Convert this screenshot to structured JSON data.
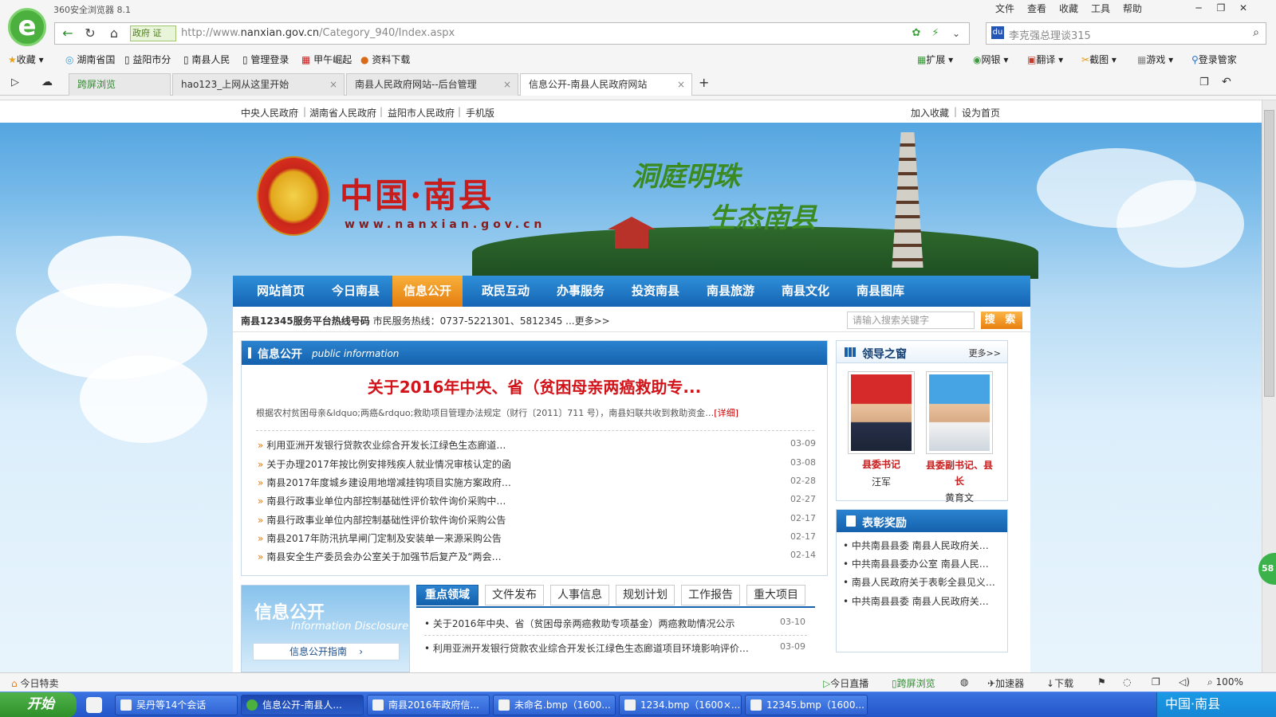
{
  "browser": {
    "app_name": "360安全浏览器 8.1",
    "menu": [
      "文件",
      "查看",
      "收藏",
      "工具",
      "帮助"
    ],
    "gov_badge": "政府 证",
    "url_prefix": "http://www.",
    "url_domain": "nanxian.gov.cn",
    "url_path": "/Category_940/Index.aspx",
    "search_value": "李克强总理谈315",
    "bookmarks": [
      "收藏",
      "湖南省国",
      "益阳市分",
      "南县人民",
      "管理登录",
      "甲午崛起",
      "资料下载"
    ],
    "toolbar_right": [
      "扩展",
      "网银",
      "翻译",
      "截图",
      "游戏",
      "登录管家"
    ],
    "tabs": [
      {
        "label": "跨屏浏览"
      },
      {
        "label": "hao123_上网从这里开始"
      },
      {
        "label": "南县人民政府网站--后台管理"
      },
      {
        "label": "信息公开-南县人民政府网站"
      }
    ]
  },
  "site": {
    "top_links": [
      "中央人民政府",
      "湖南省人民政府",
      "益阳市人民政府",
      "手机版"
    ],
    "top_right": [
      "加入收藏",
      "设为首页"
    ],
    "name": "中国·南县",
    "url": "www.nanxian.gov.cn",
    "slogan_1": "洞庭明珠",
    "slogan_2": "生态南县",
    "nav": [
      "网站首页",
      "今日南县",
      "信息公开",
      "政民互动",
      "办事服务",
      "投资南县",
      "南县旅游",
      "南县文化",
      "南县图库"
    ],
    "active_nav": "信息公开",
    "hotline_title": "南县12345服务平台热线号码",
    "hotline_text": "市民服务热线：0737-5221301、5812345 ...更多>>",
    "search_placeholder": "请输入搜索关键字",
    "search_button": "搜 索"
  },
  "info": {
    "title": "信息公开",
    "title_en": "public information",
    "headline": "关于2016年中央、省（贫困母亲两癌救助专...",
    "summary": "根据农村贫困母亲&ldquo;两癌&rdquo;救助项目管理办法规定（财行〔2011〕711 号），南县妇联共收到救助资金…",
    "detail_link": "[详细]",
    "news": [
      {
        "title": "利用亚洲开发银行贷款农业综合开发长江绿色生态廊道…",
        "date": "03-09"
      },
      {
        "title": "关于办理2017年按比例安排残疾人就业情况审核认定的函",
        "date": "03-08"
      },
      {
        "title": "南县2017年度城乡建设用地增减挂钩项目实施方案政府…",
        "date": "02-28"
      },
      {
        "title": "南县行政事业单位内部控制基础性评价软件询价采购中…",
        "date": "02-27"
      },
      {
        "title": "南县行政事业单位内部控制基础性评价软件询价采购公告",
        "date": "02-17"
      },
      {
        "title": "南县2017年防汛抗旱闸门定制及安装单一来源采购公告",
        "date": "02-17"
      },
      {
        "title": "南县安全生产委员会办公室关于加强节后复产及“两会…",
        "date": "02-14"
      }
    ]
  },
  "disclosure": {
    "title": "信息公开",
    "title_en": "Information Disclosure",
    "guide": "信息公开指南"
  },
  "bottom_tabs": [
    "重点领域",
    "文件发布",
    "人事信息",
    "规划计划",
    "工作报告",
    "重大项目"
  ],
  "bottom_news": [
    {
      "title": "关于2016年中央、省（贫困母亲两癌救助专项基金）两癌救助情况公示",
      "date": "03-10"
    },
    {
      "title": "利用亚洲开发银行贷款农业综合开发长江绿色生态廊道项目环境影响评价…",
      "date": "03-09"
    }
  ],
  "leaders": {
    "title": "领导之窗",
    "more": "更多>>",
    "people": [
      {
        "role": "县委书记",
        "name": "汪军"
      },
      {
        "role": "县委副书记、县长",
        "name": "黄育文"
      }
    ]
  },
  "awards": {
    "title": "表彰奖励",
    "items": [
      "中共南县县委 南县人民政府关…",
      "中共南县县委办公室 南县人民…",
      "南县人民政府关于表彰全县见义…",
      "中共南县县委 南县人民政府关…"
    ]
  },
  "status": {
    "left": "今日特卖",
    "right": [
      "今日直播",
      "跨屏浏览",
      "加速器",
      "下载",
      "100%"
    ]
  },
  "taskbar": {
    "start": "开始",
    "tasks": [
      "吴丹等14个会话",
      "信息公开-南县人...",
      "南县2016年政府信...",
      "未命名.bmp（1600...",
      "1234.bmp（1600×...",
      "12345.bmp（1600..."
    ],
    "tray_text": "中国·南县"
  },
  "side_badge": "58"
}
